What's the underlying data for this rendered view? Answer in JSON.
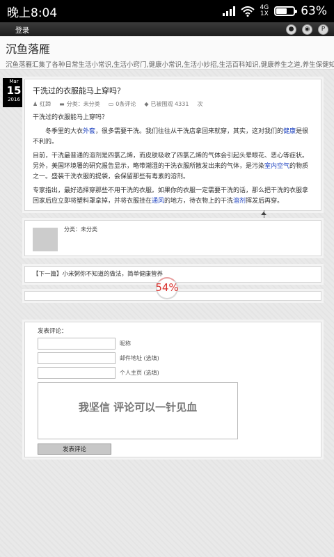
{
  "status_bar": {
    "time": "晚上8:04",
    "network_type": "4G",
    "network_sub": "1X",
    "battery_percent": "63%",
    "battery_level": 0.63,
    "icons": [
      "signal-icon",
      "wifi-icon",
      "battery-icon"
    ]
  },
  "nav": {
    "login_label": "登录",
    "icons": [
      "qq-icon",
      "weibo-icon",
      "settings-icon"
    ]
  },
  "site": {
    "title": "沉鱼落雁",
    "description": "沉鱼落雁汇集了各种日常生活小常识,生活小窍门,健康小常识,生活小妙招,生活百科知识,健康养生之道,养生保健知识"
  },
  "post": {
    "date_month": "Mar",
    "date_day": "15",
    "date_year": "2016",
    "title": "干洗过的衣服能马上穿吗？",
    "meta": {
      "author": "红蹄",
      "category": "分类：未分类",
      "comments": "0条评论",
      "views": "已被围观 4331",
      "views_unit": "次"
    },
    "body": {
      "p1": "干洗过的衣服能马上穿吗？",
      "p2_a": "冬季里的大衣",
      "p2_link1": "外套",
      "p2_b": "，很多需要干洗。我们往往从干洗店拿回来就穿，其实，这对我们的",
      "p2_link2": "健康",
      "p2_c": "是很不利的。",
      "p3_a": "目前，干洗最普通的溶剂是四氯乙烯，而皮肤吸收了四氯乙烯的气体会引起头晕眼花、恶心等症状。另外，美国环境署的研究报告显示，略带潮湿的干洗衣服所散发出来的气体，是污染",
      "p3_link": "室内空气",
      "p3_b": "的物质之一。盛装干洗衣服的提袋，会保留那些有毒素的溶剂。",
      "p4_a": "专家指出，最好选择穿那些不用干洗的衣服。如果你的衣服一定需要干洗的话，那么把干洗的衣服拿回家后应立即将塑料罩拿掉，并将衣服挂在",
      "p4_link1": "通风",
      "p4_b": "的地方，待衣物上的干洗",
      "p4_link2": "溶剂",
      "p4_c": "挥发后再穿。"
    }
  },
  "category_box": {
    "label": "分类：未分类"
  },
  "next_post": {
    "label": "【下一篇】小米粥你不知道的做法，简单健康营养"
  },
  "progress": {
    "label": "54%",
    "value": 0.54
  },
  "comment_form": {
    "heading": "发表评论：",
    "name_label": "昵称",
    "email_label": "邮件地址 (选填)",
    "website_label": "个人主页 (选填)",
    "textarea_placeholder": "我坚信 评论可以一针见血",
    "submit_label": "发表评论"
  }
}
